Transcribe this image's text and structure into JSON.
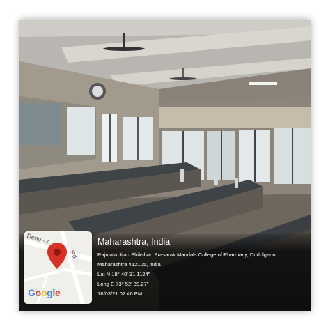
{
  "geotag": {
    "location_title": "Maharashtra, India",
    "address_line_1": "Rajmata Jijau Shikshan Prasarak Mandals College of Pharmacy, Dudulgaon,",
    "address_line_2": "Maharashtra 412105, India",
    "latitude": "Lat N 18° 40' 31.1124\"",
    "longitude": "Long E 73° 52' 39.27\"",
    "timestamp": "18/03/21 02:46 PM"
  },
  "map": {
    "road_label_a": "Dehu - A",
    "road_label_b": "Rd",
    "logo_text": "Google",
    "logo_letters": [
      "G",
      "o",
      "o",
      "g",
      "l",
      "e"
    ],
    "logo_colors": [
      "#4285F4",
      "#EA4335",
      "#FBBC05",
      "#4285F4",
      "#34A853",
      "#EA4335"
    ],
    "pin_icon": "location-pin-icon",
    "pin_color": "#d93025"
  }
}
